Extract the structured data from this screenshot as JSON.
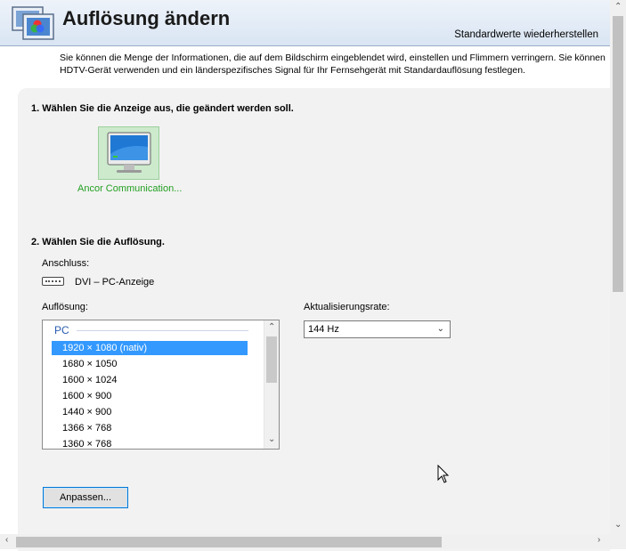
{
  "header": {
    "title": "Auflösung ändern",
    "restore_link": "Standardwerte wiederherstellen"
  },
  "intro": {
    "text": "Sie können die Menge der Informationen, die auf dem Bildschirm eingeblendet wird, einstellen und Flimmern verringern. Sie können HDTV-Gerät verwenden und ein länderspezifisches Signal für Ihr Fernsehgerät mit Standardauflösung festlegen."
  },
  "section1": {
    "title": "1. Wählen Sie die Anzeige aus, die geändert werden soll.",
    "display_label": "Ancor Communication..."
  },
  "section2": {
    "title": "2. Wählen Sie die Auflösung.",
    "connector_label": "Anschluss:",
    "connector_value": "DVI – PC-Anzeige",
    "resolution_label": "Auflösung:",
    "group": "PC",
    "resolutions": [
      "1920 × 1080 (nativ)",
      "1680 × 1050",
      "1600 × 1024",
      "1600 × 900",
      "1440 × 900",
      "1366 × 768",
      "1360 × 768"
    ],
    "selected_resolution": "1920 × 1080 (nativ)",
    "refresh_label": "Aktualisierungsrate:",
    "refresh_value": "144 Hz"
  },
  "buttons": {
    "customize": "Anpassen..."
  },
  "colors": {
    "selection": "#3399ff",
    "display_label": "#22a022",
    "group_header": "#2a5db0"
  },
  "icons": {
    "header": "display-settings-icon",
    "display": "monitor-icon",
    "connector": "dvi-connector-icon"
  }
}
